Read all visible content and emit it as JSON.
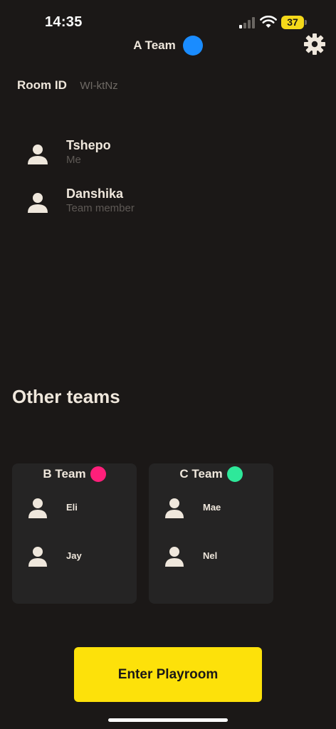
{
  "status_bar": {
    "time": "14:35",
    "battery_level": "37",
    "signal_bars_active": 1,
    "signal_bars_total": 4
  },
  "header": {
    "team_name": "A Team",
    "team_color": "#1a8cff",
    "settings_icon": "gear-icon"
  },
  "room": {
    "label": "Room ID",
    "value": "WI-ktNz"
  },
  "members": [
    {
      "name": "Tshepo",
      "role": "Me"
    },
    {
      "name": "Danshika",
      "role": "Team member"
    }
  ],
  "other_teams_title": "Other teams",
  "other_teams": [
    {
      "name": "B Team",
      "color": "#ff1f7a",
      "members": [
        "Eli",
        "Jay"
      ]
    },
    {
      "name": "C Team",
      "color": "#2ee89a",
      "members": [
        "Mae",
        "Nel"
      ]
    }
  ],
  "enter_button_label": "Enter Playroom",
  "colors": {
    "background": "#1b1817",
    "accent": "#fde10a",
    "card": "#252424",
    "text": "#efe7dc"
  }
}
